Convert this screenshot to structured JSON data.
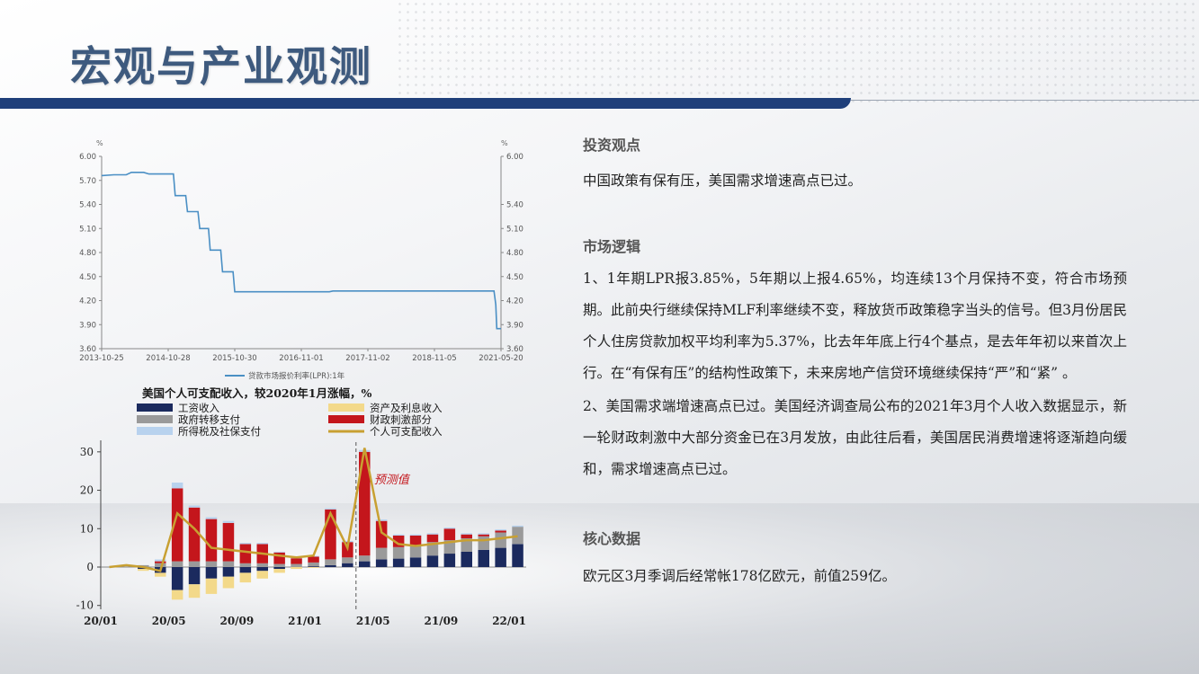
{
  "header": {
    "title": "宏观与产业观测"
  },
  "sections": {
    "view": {
      "heading": "投资观点",
      "text": "中国政策有保有压，美国需求增速高点已过。"
    },
    "logic": {
      "heading": "市场逻辑",
      "p1": "1、1年期LPR报3.85%，5年期以上报4.65%，均连续13个月保持不变，符合市场预期。此前央行继续保持MLF利率继续不变，释放货币政策稳字当头的信号。但3月份居民个人住房贷款加权平均利率为5.37%，比去年年底上行4个基点，是去年年初以来首次上行。在“有保有压”的结构性政策下，未来房地产信贷环境继续保持“严”和“紧” 。",
      "p2": "2、美国需求端增速高点已过。美国经济调查局公布的2021年3月个人收入数据显示，新一轮财政刺激中大部分资金已在3月发放，由此往后看，美国居民消费增速将逐渐趋向缓和，需求增速高点已过。"
    },
    "core": {
      "heading": "核心数据",
      "text": "欧元区3月季调后经常帐178亿欧元，前值259亿。"
    }
  },
  "chart_data": [
    {
      "type": "line",
      "title": "",
      "ylabel_left": "%",
      "ylabel_right": "%",
      "y_ticks": [
        "6.00",
        "5.70",
        "5.40",
        "5.10",
        "4.80",
        "4.50",
        "4.20",
        "3.90",
        "3.60"
      ],
      "y_ticks_right": [
        "6.00",
        "5.40",
        "5.10",
        "4.80",
        "4.50",
        "4.20",
        "3.90",
        "3.60"
      ],
      "ylim": [
        3.6,
        6.0
      ],
      "x_ticks": [
        "2013-10-25",
        "2014-10-28",
        "2015-10-30",
        "2016-11-01",
        "2017-11-02",
        "2018-11-05",
        "2021-05-20"
      ],
      "series": [
        {
          "name": "贷款市场报价利率(LPR):1年",
          "color": "#4a8fc4",
          "points": [
            [
              0.0,
              5.76
            ],
            [
              0.35,
              5.77
            ],
            [
              0.7,
              5.77
            ],
            [
              0.85,
              5.8
            ],
            [
              1.2,
              5.8
            ],
            [
              1.35,
              5.78
            ],
            [
              2.05,
              5.78
            ],
            [
              2.1,
              5.51
            ],
            [
              2.4,
              5.51
            ],
            [
              2.45,
              5.31
            ],
            [
              2.75,
              5.31
            ],
            [
              2.8,
              5.1
            ],
            [
              3.05,
              5.1
            ],
            [
              3.1,
              4.83
            ],
            [
              3.4,
              4.83
            ],
            [
              3.45,
              4.56
            ],
            [
              3.75,
              4.56
            ],
            [
              3.8,
              4.31
            ],
            [
              6.5,
              4.31
            ],
            [
              6.6,
              4.32
            ],
            [
              11.2,
              4.32
            ],
            [
              11.25,
              4.15
            ],
            [
              11.28,
              3.85
            ],
            [
              11.4,
              3.85
            ]
          ]
        }
      ]
    },
    {
      "type": "bar",
      "title": "美国个人可支配收入，较2020年1月涨幅，%",
      "annotation": "预测值",
      "y_ticks": [
        "30",
        "20",
        "10",
        "0",
        "-10"
      ],
      "ylim": [
        -11,
        33
      ],
      "x_ticks": [
        "20/01",
        "20/05",
        "20/09",
        "21/01",
        "21/05",
        "21/09",
        "22/01"
      ],
      "n_months": 25,
      "forecast_start_index": 15,
      "series": [
        {
          "name": "工资收入",
          "color": "#1b2a5e",
          "values": [
            0,
            0,
            -0.5,
            -1.5,
            -6,
            -4.5,
            -3,
            -2.5,
            -1.5,
            -1,
            -0.5,
            0,
            0.2,
            0.5,
            1,
            1.5,
            2,
            2.2,
            2.5,
            3,
            3.5,
            4,
            4.5,
            5,
            6
          ]
        },
        {
          "name": "资产及利息收入",
          "color": "#f3d98a",
          "values": [
            0,
            0,
            -0.5,
            -1,
            -2.5,
            -3.5,
            -4,
            -3,
            -2.5,
            -2,
            -1,
            -0.5,
            -0.2,
            0,
            0,
            0,
            0,
            0,
            0,
            0,
            0,
            0,
            0,
            0,
            0
          ]
        },
        {
          "name": "政府转移支付",
          "color": "#9a9a9a",
          "values": [
            0,
            0,
            0.5,
            1,
            1.5,
            1.5,
            1.5,
            1.5,
            1,
            1,
            0.8,
            0.8,
            1,
            1.5,
            1.5,
            1.5,
            3,
            3,
            3.2,
            3.5,
            3.5,
            3.5,
            3.5,
            4,
            4.5
          ]
        },
        {
          "name": "财政刺激部分",
          "color": "#c4161c",
          "values": [
            0,
            0,
            0,
            0.5,
            19,
            14,
            11,
            10,
            5,
            5,
            3,
            1.5,
            1.5,
            13,
            4,
            27,
            7,
            3,
            2.5,
            2,
            3,
            1,
            0.5,
            0.5,
            0
          ]
        },
        {
          "name": "所得税及社保支付",
          "color": "#b8d2ee",
          "values": [
            0,
            0,
            0,
            0.5,
            1.5,
            0.5,
            0.5,
            0.5,
            0.3,
            0.3,
            0.2,
            0.2,
            0.2,
            0.3,
            0.3,
            0.5,
            0.4,
            0.3,
            0.3,
            0.3,
            0.3,
            0.3,
            0.3,
            0.3,
            0.3
          ]
        }
      ],
      "line": {
        "name": "个人可支配收入",
        "color": "#c8a032",
        "values": [
          0,
          0.5,
          0,
          -1,
          14,
          10,
          5,
          4.5,
          4,
          3.5,
          3,
          2.5,
          3,
          14,
          5,
          31,
          9,
          6,
          5.5,
          6,
          6.5,
          7,
          7,
          7.5,
          8
        ]
      }
    }
  ]
}
